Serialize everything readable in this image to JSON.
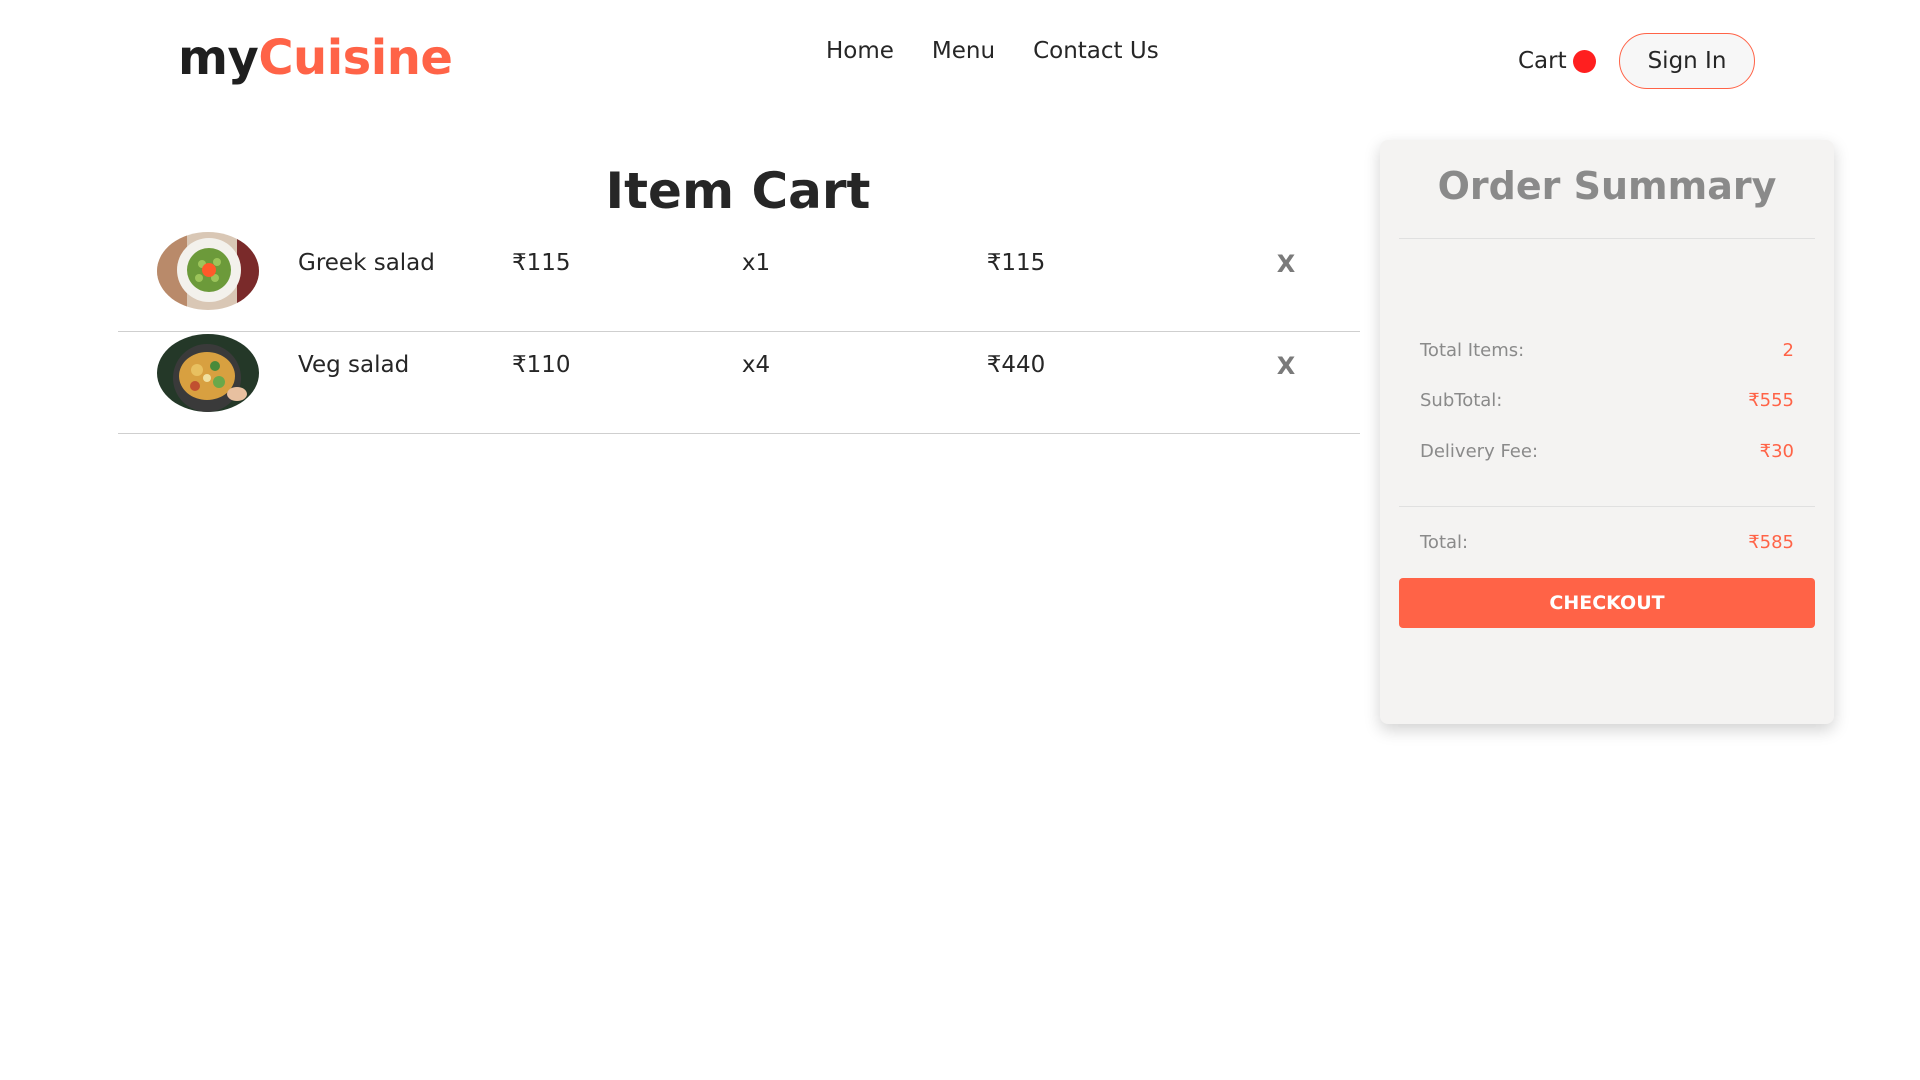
{
  "header": {
    "logo_part1": "my",
    "logo_part2": "Cuisine",
    "nav": [
      "Home",
      "Menu",
      "Contact Us"
    ],
    "cart_label": "Cart",
    "signin_label": "Sign In"
  },
  "cart": {
    "title": "Item Cart",
    "items": [
      {
        "name": "Greek salad",
        "price": "₹115",
        "quantity": "x1",
        "total": "₹115",
        "remove": "X"
      },
      {
        "name": "Veg salad",
        "price": "₹110",
        "quantity": "x4",
        "total": "₹440",
        "remove": "X"
      }
    ]
  },
  "summary": {
    "title": "Order Summary",
    "total_items_label": "Total Items:",
    "total_items_value": "2",
    "subtotal_label": "SubTotal:",
    "subtotal_value": "₹555",
    "delivery_label": "Delivery Fee:",
    "delivery_value": "₹30",
    "total_label": "Total:",
    "total_value": "₹585",
    "checkout_label": "CHECKOUT"
  },
  "colors": {
    "accent": "#ff6347",
    "cart_badge": "#ff1f1f",
    "summary_bg": "#f4f3f2"
  }
}
